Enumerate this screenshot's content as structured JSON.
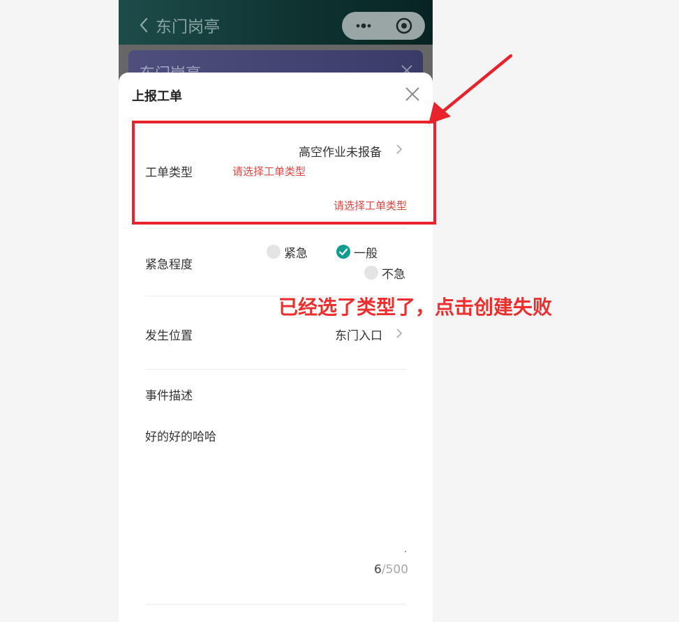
{
  "navbar": {
    "title": "东门岗亭"
  },
  "background_card": {
    "title": "东门岗亭"
  },
  "sheet": {
    "title": "上报工单",
    "ticket_type": {
      "label": "工单类型",
      "value": "高空作业未报备",
      "inline_error": "请选择工单类型",
      "error": "请选择工单类型"
    },
    "urgency": {
      "label": "紧急程度",
      "options": [
        "紧急",
        "一般",
        "不急"
      ],
      "selected": "一般"
    },
    "location": {
      "label": "发生位置",
      "value": "东门入口"
    },
    "description": {
      "label": "事件描述",
      "value": "好的好的哈哈",
      "count": "6",
      "max": "/500"
    }
  },
  "annotation": {
    "text": "已经选了类型了，点击创建失败"
  },
  "colors": {
    "accent": "#129c8f",
    "error": "#e0463f",
    "annotation": "#ee2d2d"
  }
}
